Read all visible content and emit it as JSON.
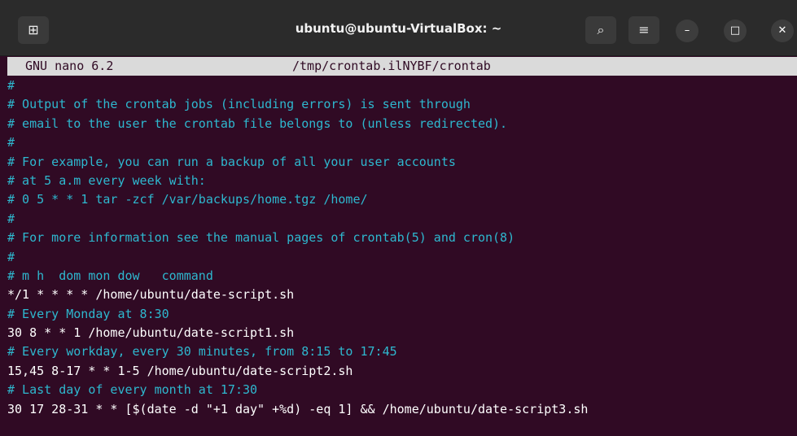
{
  "window": {
    "title": "ubuntu@ubuntu-VirtualBox: ~",
    "icons": {
      "new_tab": "new-tab-icon",
      "search": "search-icon",
      "menu": "hamburger-menu-icon",
      "minimize": "minimize-icon",
      "maximize": "maximize-icon",
      "close": "close-icon"
    }
  },
  "nano": {
    "version": "GNU nano 6.2",
    "filename": "/tmp/crontab.ilNYBF/crontab"
  },
  "colors": {
    "background": "#300a24",
    "comment": "#2eb8cf",
    "text": "#ffffff",
    "header_bg": "#dadada"
  },
  "lines": [
    {
      "text": "#",
      "kind": "comment"
    },
    {
      "text": "# Output of the crontab jobs (including errors) is sent through",
      "kind": "comment"
    },
    {
      "text": "# email to the user the crontab file belongs to (unless redirected).",
      "kind": "comment"
    },
    {
      "text": "#",
      "kind": "comment"
    },
    {
      "text": "# For example, you can run a backup of all your user accounts",
      "kind": "comment"
    },
    {
      "text": "# at 5 a.m every week with:",
      "kind": "comment"
    },
    {
      "text": "# 0 5 * * 1 tar -zcf /var/backups/home.tgz /home/",
      "kind": "comment"
    },
    {
      "text": "#",
      "kind": "comment"
    },
    {
      "text": "# For more information see the manual pages of crontab(5) and cron(8)",
      "kind": "comment"
    },
    {
      "text": "#",
      "kind": "comment"
    },
    {
      "text": "# m h  dom mon dow   command",
      "kind": "comment"
    },
    {
      "text": "*/1 * * * * /home/ubuntu/date-script.sh",
      "kind": "code"
    },
    {
      "text": "# Every Monday at 8:30",
      "kind": "comment"
    },
    {
      "text": "30 8 * * 1 /home/ubuntu/date-script1.sh",
      "kind": "code"
    },
    {
      "text": "# Every workday, every 30 minutes, from 8:15 to 17:45",
      "kind": "comment"
    },
    {
      "text": "15,45 8-17 * * 1-5 /home/ubuntu/date-script2.sh",
      "kind": "code"
    },
    {
      "text": "# Last day of every month at 17:30",
      "kind": "comment"
    },
    {
      "text": "30 17 28-31 * * [$(date -d \"+1 day\" +%d) -eq 1] && /home/ubuntu/date-script3.sh",
      "kind": "code"
    }
  ]
}
